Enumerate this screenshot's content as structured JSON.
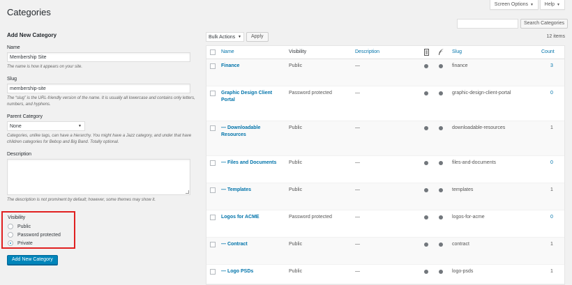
{
  "header": {
    "title": "Categories",
    "screen_options": "Screen Options",
    "help": "Help"
  },
  "form": {
    "heading": "Add New Category",
    "name_label": "Name",
    "name_value": "Membership Site",
    "name_desc": "The name is how it appears on your site.",
    "slug_label": "Slug",
    "slug_value": "membership-site",
    "slug_desc": "The “slug” is the URL-friendly version of the name. It is usually all lowercase and contains only letters, numbers, and hyphens.",
    "parent_label": "Parent Category",
    "parent_value": "None",
    "parent_desc": "Categories, unlike tags, can have a hierarchy. You might have a Jazz category, and under that have children categories for Bebop and Big Band. Totally optional.",
    "description_label": "Description",
    "description_desc": "The description is not prominent by default; however, some themes may show it.",
    "visibility_label": "Visibility",
    "visibility_options": [
      "Public",
      "Password protected",
      "Private"
    ],
    "visibility_selected": "Private",
    "submit_label": "Add New Category"
  },
  "list": {
    "search_button": "Search Categories",
    "bulk_actions": "Bulk Actions",
    "apply": "Apply",
    "items_count": "12 items",
    "columns": {
      "name": "Name",
      "visibility": "Visibility",
      "description": "Description",
      "slug": "Slug",
      "count": "Count"
    },
    "rows": [
      {
        "name": "Finance",
        "visibility": "Public",
        "description": "—",
        "slug": "finance",
        "count": "3",
        "count_link": true
      },
      {
        "name": "Graphic Design Client Portal",
        "visibility": "Password protected",
        "description": "—",
        "slug": "graphic-design-client-portal",
        "count": "0",
        "count_link": true
      },
      {
        "name": "— Downloadable Resources",
        "visibility": "Public",
        "description": "—",
        "slug": "downloadable-resources",
        "count": "1",
        "count_link": false
      },
      {
        "name": "— Files and Documents",
        "visibility": "Public",
        "description": "—",
        "slug": "files-and-documents",
        "count": "0",
        "count_link": true
      },
      {
        "name": "— Templates",
        "visibility": "Public",
        "description": "—",
        "slug": "templates",
        "count": "1",
        "count_link": false
      },
      {
        "name": "Logos for ACME",
        "visibility": "Password protected",
        "description": "—",
        "slug": "logos-for-acme",
        "count": "0",
        "count_link": true
      },
      {
        "name": "— Contract",
        "visibility": "Public",
        "description": "—",
        "slug": "contract",
        "count": "1",
        "count_link": false
      },
      {
        "name": "— Logo PSDs",
        "visibility": "Public",
        "description": "—",
        "slug": "logo-psds",
        "count": "1",
        "count_link": false
      }
    ]
  },
  "icons": {
    "col1": "document-icon",
    "col2": "feather-icon",
    "status_dot": "status-dot"
  },
  "colors": {
    "link": "#0073aa",
    "primary": "#0085ba",
    "highlight_border": "#e02020"
  }
}
